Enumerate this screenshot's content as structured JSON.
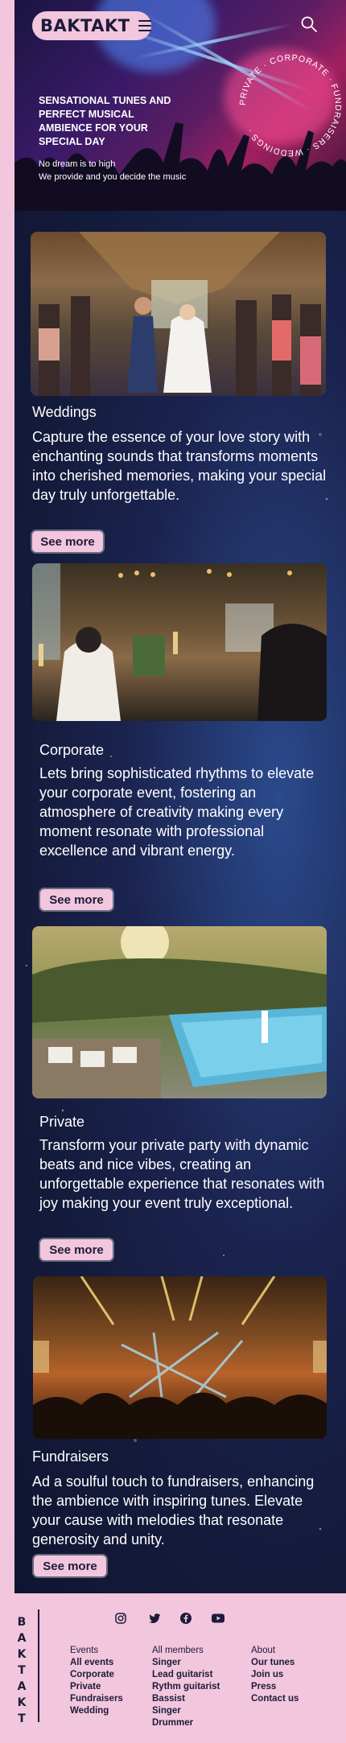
{
  "brand": {
    "wordmark": "BAKTAKT",
    "vertical_letters": [
      "B",
      "A",
      "K",
      "T",
      "A",
      "K",
      "T"
    ]
  },
  "hero": {
    "headline": "SENSATIONAL TUNES AND PERFECT MUSICAL AMBIENCE FOR YOUR SPECIAL DAY",
    "sub_line_1": "No dream is to high",
    "sub_line_2": "We provide and you decide the music",
    "ring_text": "PRIVATE · CORPORATE · FUNDRAISERS · WEDDINGS ·"
  },
  "sections": [
    {
      "title": "Weddings",
      "body": "Capture the essence of your love story with enchanting sounds that transforms moments into cherished memories, making your special day truly unforgettable.",
      "button": "See more"
    },
    {
      "title": "Corporate",
      "body": "Lets bring sophisticated rhythms to elevate your corporate event, fostering an atmosphere of creativity making every moment resonate with professional excellence and vibrant energy.",
      "button": "See more"
    },
    {
      "title": "Private",
      "body": "Transform your private party with dynamic beats and nice vibes, creating an unforgettable experience that resonates with joy making your event truly exceptional.",
      "button": "See more"
    },
    {
      "title": "Fundraisers",
      "body": "Ad a soulful touch to fundraisers, enhancing the ambience with inspiring tunes. Elevate your cause with melodies that resonate generosity and unity.",
      "button": "See more"
    }
  ],
  "footer": {
    "social": [
      "instagram-icon",
      "twitter-icon",
      "facebook-icon",
      "youtube-icon"
    ],
    "events": {
      "heading": "Events",
      "links": [
        "All events",
        "Corporate",
        "Private",
        "Fundraisers",
        "Wedding"
      ]
    },
    "members": {
      "heading": "All members",
      "links": [
        "Singer",
        "Lead guitarist",
        "Rythm guitarist",
        "Bassist",
        "Singer",
        "Drummer"
      ]
    },
    "about": {
      "heading": "About",
      "links": [
        "Our tunes",
        "Join us",
        "Press",
        "Contact us"
      ]
    }
  },
  "colors": {
    "pink": "#f2c6dc",
    "navy": "#1d1b3b",
    "bg": "#1b2450"
  }
}
